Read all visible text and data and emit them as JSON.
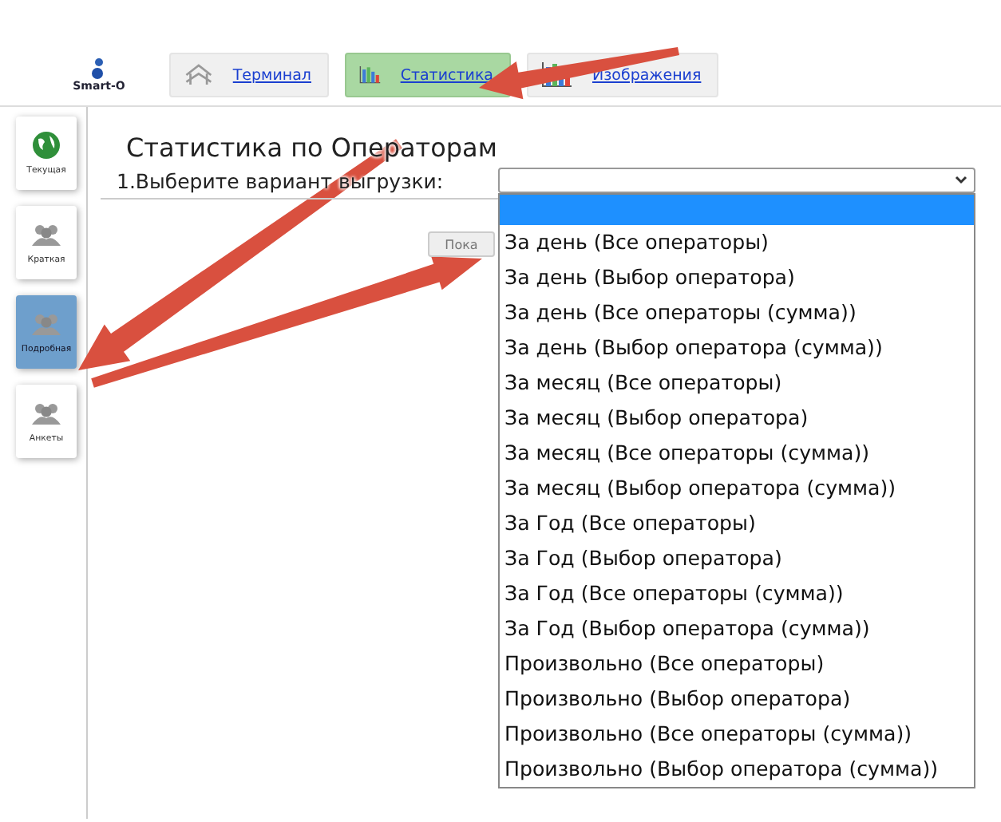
{
  "logo": {
    "text": "Smart-O"
  },
  "tabs": [
    {
      "label": "Терминал",
      "selected": false
    },
    {
      "label": "Статистика",
      "selected": true
    },
    {
      "label": "Изображения",
      "selected": false
    }
  ],
  "sidebar": {
    "items": [
      {
        "label": "Текущая",
        "selected": false
      },
      {
        "label": "Краткая",
        "selected": false
      },
      {
        "label": "Подробная",
        "selected": true
      },
      {
        "label": "Анкеты",
        "selected": false
      }
    ]
  },
  "page": {
    "title": "Статистика по Операторам",
    "prompt": "1.Выберите вариант выгрузки:",
    "button": "Пока"
  },
  "dropdown": {
    "expanded": true,
    "options": [
      {
        "selected": true
      },
      {
        "label": "За день (Все операторы)",
        "selected": false
      },
      {
        "label": "За день (Выбор оператора)",
        "selected": false
      },
      {
        "label": "За день (Все операторы (сумма))",
        "selected": false
      },
      {
        "label": "За день (Выбор оператора (сумма))",
        "selected": false
      },
      {
        "label": "За месяц (Все операторы)",
        "selected": false
      },
      {
        "label": "За месяц (Выбор оператора)",
        "selected": false
      },
      {
        "label": "За месяц (Все операторы (сумма))",
        "selected": false
      },
      {
        "label": "За месяц (Выбор оператора (сумма))",
        "selected": false
      },
      {
        "label": "За Год (Все операторы)",
        "selected": false
      },
      {
        "label": "За Год (Выбор оператора)",
        "selected": false
      },
      {
        "label": "За Год (Все операторы (сумма))",
        "selected": false
      },
      {
        "label": "За Год (Выбор оператора (сумма))",
        "selected": false
      },
      {
        "label": "Произвольно (Все операторы)",
        "selected": false
      },
      {
        "label": "Произвольно (Выбор оператора)",
        "selected": false
      },
      {
        "label": "Произвольно (Все операторы (сумма))",
        "selected": false
      },
      {
        "label": "Произвольно (Выбор оператора (сумма))",
        "selected": false
      }
    ]
  }
}
